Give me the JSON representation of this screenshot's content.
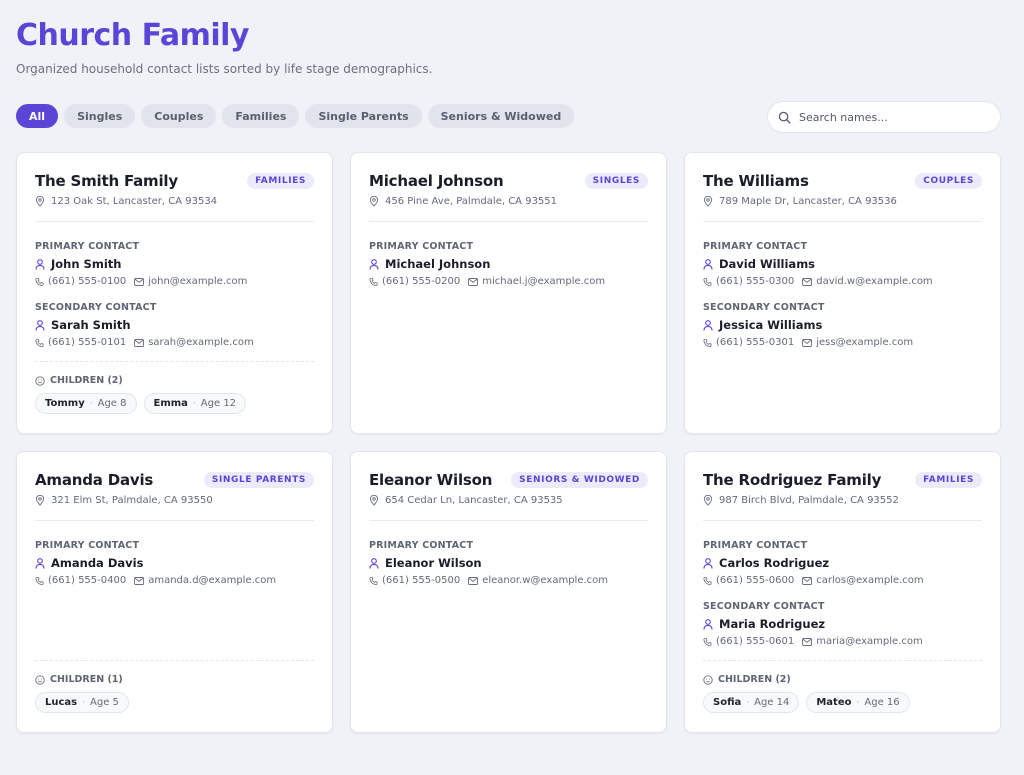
{
  "header": {
    "title": "Church Family",
    "subtitle": "Organized household contact lists sorted by life stage demographics."
  },
  "filters": [
    {
      "label": "All",
      "active": true
    },
    {
      "label": "Singles"
    },
    {
      "label": "Couples"
    },
    {
      "label": "Families"
    },
    {
      "label": "Single Parents"
    },
    {
      "label": "Seniors & Widowed"
    }
  ],
  "search": {
    "placeholder": "Search names..."
  },
  "colors": {
    "accent": "#5b45d6",
    "background": "#f1f2f7"
  },
  "cards": [
    {
      "name": "The Smith Family",
      "badge": "FAMILIES",
      "address": "123 Oak St, Lancaster, CA 93534",
      "primary_label": "PRIMARY CONTACT",
      "primary": {
        "name": "John Smith",
        "phone": "(661) 555-0100",
        "email": "john@example.com"
      },
      "secondary_label": "SECONDARY CONTACT",
      "secondary": {
        "name": "Sarah Smith",
        "phone": "(661) 555-0101",
        "email": "sarah@example.com"
      },
      "children_label": "CHILDREN (2)",
      "children": [
        {
          "name": "Tommy",
          "dot": "·",
          "age": "Age 8"
        },
        {
          "name": "Emma",
          "dot": "·",
          "age": "Age 12"
        }
      ]
    },
    {
      "name": "Michael Johnson",
      "badge": "SINGLES",
      "address": "456 Pine Ave, Palmdale, CA 93551",
      "primary_label": "PRIMARY CONTACT",
      "primary": {
        "name": "Michael Johnson",
        "phone": "(661) 555-0200",
        "email": "michael.j@example.com"
      }
    },
    {
      "name": "The Williams",
      "badge": "COUPLES",
      "address": "789 Maple Dr, Lancaster, CA 93536",
      "primary_label": "PRIMARY CONTACT",
      "primary": {
        "name": "David Williams",
        "phone": "(661) 555-0300",
        "email": "david.w@example.com"
      },
      "secondary_label": "SECONDARY CONTACT",
      "secondary": {
        "name": "Jessica Williams",
        "phone": "(661) 555-0301",
        "email": "jess@example.com"
      }
    },
    {
      "name": "Amanda Davis",
      "badge": "SINGLE PARENTS",
      "address": "321 Elm St, Palmdale, CA 93550",
      "primary_label": "PRIMARY CONTACT",
      "primary": {
        "name": "Amanda Davis",
        "phone": "(661) 555-0400",
        "email": "amanda.d@example.com"
      },
      "children_label": "CHILDREN (1)",
      "children": [
        {
          "name": "Lucas",
          "dot": "·",
          "age": "Age 5"
        }
      ]
    },
    {
      "name": "Eleanor Wilson",
      "badge": "SENIORS & WIDOWED",
      "address": "654 Cedar Ln, Lancaster, CA 93535",
      "primary_label": "PRIMARY CONTACT",
      "primary": {
        "name": "Eleanor Wilson",
        "phone": "(661) 555-0500",
        "email": "eleanor.w@example.com"
      }
    },
    {
      "name": "The Rodriguez Family",
      "badge": "FAMILIES",
      "address": "987 Birch Blvd, Palmdale, CA 93552",
      "primary_label": "PRIMARY CONTACT",
      "primary": {
        "name": "Carlos Rodriguez",
        "phone": "(661) 555-0600",
        "email": "carlos@example.com"
      },
      "secondary_label": "SECONDARY CONTACT",
      "secondary": {
        "name": "Maria Rodriguez",
        "phone": "(661) 555-0601",
        "email": "maria@example.com"
      },
      "children_label": "CHILDREN (2)",
      "children": [
        {
          "name": "Sofia",
          "dot": "·",
          "age": "Age 14"
        },
        {
          "name": "Mateo",
          "dot": "·",
          "age": "Age 16"
        }
      ]
    }
  ]
}
